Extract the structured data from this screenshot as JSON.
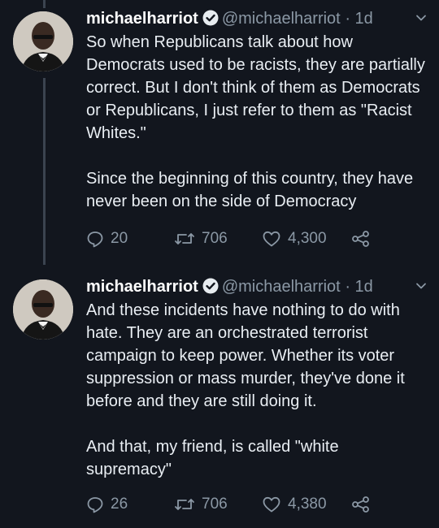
{
  "tweets": [
    {
      "name": "michaelharriot",
      "handle": "@michaelharriot",
      "separator": "·",
      "time": "1d",
      "text_1": "So when Republicans talk about how Democrats used to be racists, they are partially correct. But I don't think of them as Democrats or Republicans,  I just refer to them as \"Racist Whites.\"",
      "text_2": "Since the beginning of this country, they have never been on the side of Democracy",
      "replies": "20",
      "retweets": "706",
      "likes": "4,300"
    },
    {
      "name": "michaelharriot",
      "handle": "@michaelharriot",
      "separator": "·",
      "time": "1d",
      "text_1": "And these incidents have nothing to do with hate. They are an orchestrated terrorist campaign to keep power. Whether its voter suppression or mass murder, they've done it before and they are still doing it.",
      "text_2": "And that, my friend, is called \"white supremacy\"",
      "replies": "26",
      "retweets": "706",
      "likes": "4,380"
    }
  ],
  "icons": {
    "verified": "verified-badge-icon",
    "chevron": "chevron-down-icon",
    "reply": "reply-icon",
    "retweet": "retweet-icon",
    "like": "heart-icon",
    "share": "share-icon"
  },
  "colors": {
    "background": "#12161e",
    "text": "#e7ecf0",
    "muted": "#8b98a5"
  }
}
